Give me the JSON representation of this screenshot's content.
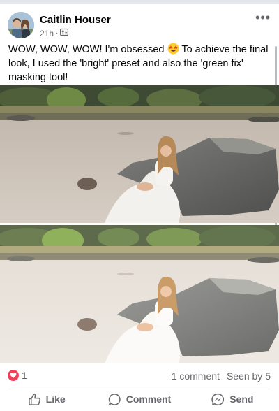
{
  "post": {
    "author": "Caitlin Houser",
    "time": "21h",
    "separator": "·",
    "more_label": "•••",
    "text_part1": "WOW, WOW, WOW! I'm obsessed",
    "text_part2": "To achieve the final look, I used the 'bright' preset and also the 'green fix' masking tool!",
    "emoji": "star-struck-emoji",
    "privacy_icon": "friends-privacy-icon"
  },
  "photos": [
    {
      "name": "before-photo",
      "description_icon": "photo"
    },
    {
      "name": "after-photo",
      "description_icon": "photo"
    }
  ],
  "stats": {
    "reaction_count": "1",
    "reaction_icon": "heart-icon",
    "comments": "1 comment",
    "seen": "Seen by 5"
  },
  "actions": {
    "like": "Like",
    "comment": "Comment",
    "send": "Send"
  },
  "colors": {
    "reaction_heart": "#f33e58",
    "secondary_text": "#65676b",
    "background": "#ffffff"
  }
}
